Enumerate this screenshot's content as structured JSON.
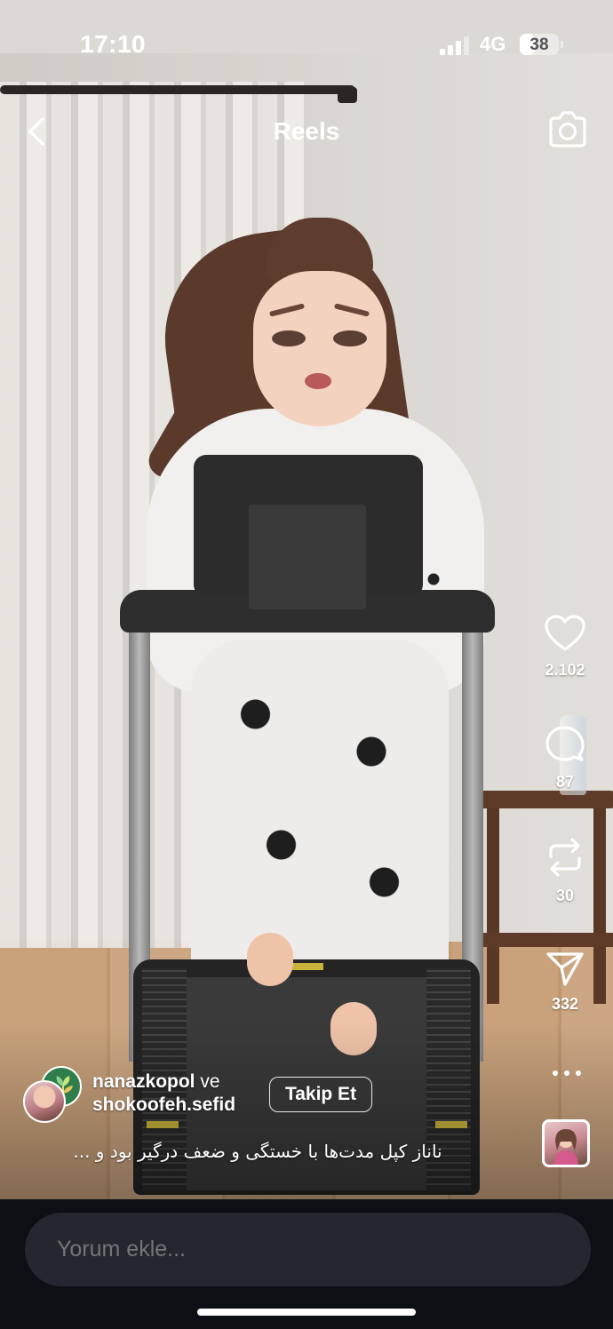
{
  "status_bar": {
    "time": "17:10",
    "network": "4G",
    "battery": "38",
    "battery_level": 0.38
  },
  "header": {
    "title": "Reels",
    "back_icon": "chevron-left-icon",
    "camera_icon": "camera-icon"
  },
  "actions": {
    "likes": "2.102",
    "comments": "87",
    "reposts": "30",
    "shares": "332"
  },
  "author": {
    "primary": "nanazkopol",
    "joiner": "ve",
    "secondary": "shokoofeh.sefid",
    "follow_label": "Takip Et"
  },
  "caption": "ناناز کپل مدت‌ها با خستگی و ضعف درگیر بود و ...",
  "comment": {
    "placeholder": "Yorum ekle..."
  },
  "colors": {
    "bottom_bar": "#0c0f14",
    "input_bg": "#232830"
  }
}
